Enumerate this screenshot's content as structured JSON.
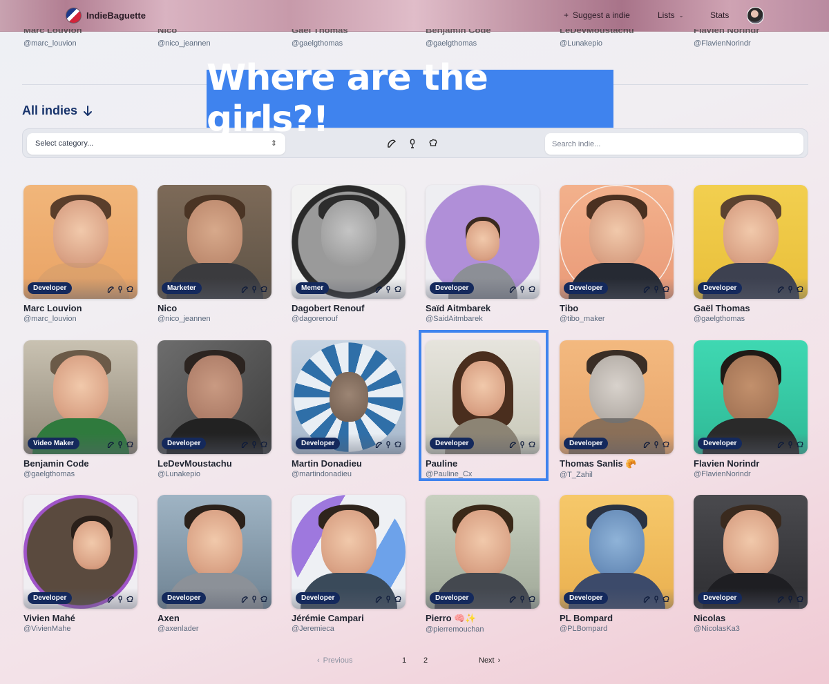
{
  "nav": {
    "brand": "IndieBaguette",
    "suggest": "Suggest a indie",
    "lists": "Lists",
    "stats": "Stats"
  },
  "strip": [
    {
      "name": "Marc Louvion",
      "handle": "@marc_louvion"
    },
    {
      "name": "Nico",
      "handle": "@nico_jeannen"
    },
    {
      "name": "Gaël Thomas",
      "handle": "@gaelgthomas"
    },
    {
      "name": "Benjamin Code",
      "handle": "@gaelgthomas"
    },
    {
      "name": "LeDevMoustachu",
      "handle": "@Lunakepio"
    },
    {
      "name": "Flavien Norindr",
      "handle": "@FlavienNorindr"
    }
  ],
  "caption": "Where are the girls?!",
  "section_title": "All indies",
  "filters": {
    "category_placeholder": "Select category...",
    "search_placeholder": "Search indie..."
  },
  "cards": [
    {
      "name": "Marc Louvion",
      "handle": "@marc_louvion",
      "role": "Developer"
    },
    {
      "name": "Nico",
      "handle": "@nico_jeannen",
      "role": "Marketer"
    },
    {
      "name": "Dagobert Renouf",
      "handle": "@dagorenouf",
      "role": "Memer"
    },
    {
      "name": "Saïd Aitmbarek",
      "handle": "@SaidAitmbarek",
      "role": "Developer"
    },
    {
      "name": "Tibo",
      "handle": "@tibo_maker",
      "role": "Developer"
    },
    {
      "name": "Gaël Thomas",
      "handle": "@gaelgthomas",
      "role": "Developer"
    },
    {
      "name": "Benjamin Code",
      "handle": "@gaelgthomas",
      "role": "Video Maker"
    },
    {
      "name": "LeDevMoustachu",
      "handle": "@Lunakepio",
      "role": "Developer"
    },
    {
      "name": "Martin Donadieu",
      "handle": "@martindonadieu",
      "role": "Developer"
    },
    {
      "name": "Pauline",
      "handle": "@Pauline_Cx",
      "role": "Developer"
    },
    {
      "name": "Thomas Sanlis 🥐",
      "handle": "@T_Zahil",
      "role": "Developer"
    },
    {
      "name": "Flavien Norindr",
      "handle": "@FlavienNorindr",
      "role": "Developer"
    },
    {
      "name": "Vivien Mahé",
      "handle": "@VivienMahe",
      "role": "Developer"
    },
    {
      "name": "Axen",
      "handle": "@axenlader",
      "role": "Developer"
    },
    {
      "name": "Jérémie Campari",
      "handle": "@Jeremieca",
      "role": "Developer"
    },
    {
      "name": "Pierro 🧠✨",
      "handle": "@pierremouchan",
      "role": "Developer"
    },
    {
      "name": "PL Bompard",
      "handle": "@PLBompard",
      "role": "Developer"
    },
    {
      "name": "Nicolas",
      "handle": "@NicolasKa3",
      "role": "Developer"
    }
  ],
  "pagination": {
    "previous": "Previous",
    "pages": [
      "1",
      "2"
    ],
    "next": "Next"
  }
}
